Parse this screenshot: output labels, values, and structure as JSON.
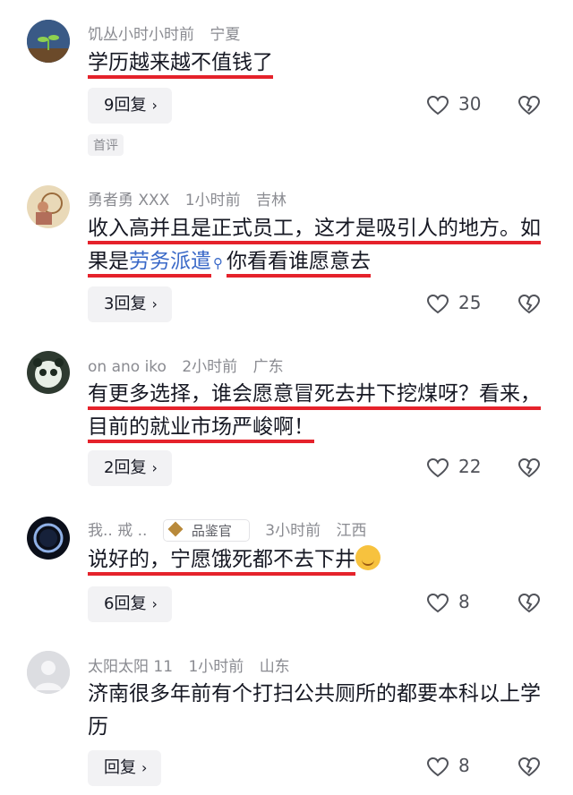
{
  "comments": [
    {
      "username": "饥丛小时小时前",
      "time": "",
      "region": "宁夏",
      "text_parts": [
        "学历越来越不值钱了"
      ],
      "reply_label": "9回复",
      "likes": "30",
      "tag": "首评",
      "avatar": "sprout-avatar"
    },
    {
      "username": "勇者勇 XXX",
      "time": "1小时前",
      "region": "吉林",
      "text_parts": [
        "收入高并且是正式员工，这才是吸引人的地方。如果是",
        "劳务派遣",
        "你看看谁愿意去"
      ],
      "reply_label": "3回复",
      "likes": "25",
      "avatar": "painting-avatar"
    },
    {
      "username": "on ano iko",
      "time": "2小时前",
      "region": "广东",
      "text_parts": [
        "有更多选择，谁会愿意冒死去井下挖煤呀？看来，目前的就业市场严峻啊！"
      ],
      "reply_label": "2回复",
      "likes": "22",
      "avatar": "panda-avatar"
    },
    {
      "username": "我.. 戒 ..",
      "badge": "品鉴官",
      "time": "3小时前",
      "region": "江西",
      "text_parts": [
        "说好的，宁愿饿死都不去下井"
      ],
      "reply_label": "6回复",
      "likes": "8",
      "avatar": "ring-avatar"
    },
    {
      "username": "太阳太阳 11",
      "time": "1小时前",
      "region": "山东",
      "text_parts": [
        "济南很多年前有个打扫公共厕所的都要本科以上学历"
      ],
      "reply_label": "回复",
      "likes": "8",
      "avatar": "default-avatar"
    }
  ],
  "colors": {
    "underline": "#e5222b",
    "link": "#3a69c8",
    "meta": "#8a8b91"
  },
  "icons": {
    "like": "heart-outline-icon",
    "dislike": "broken-heart-icon",
    "reply_chevron": "chevron-right-icon"
  }
}
